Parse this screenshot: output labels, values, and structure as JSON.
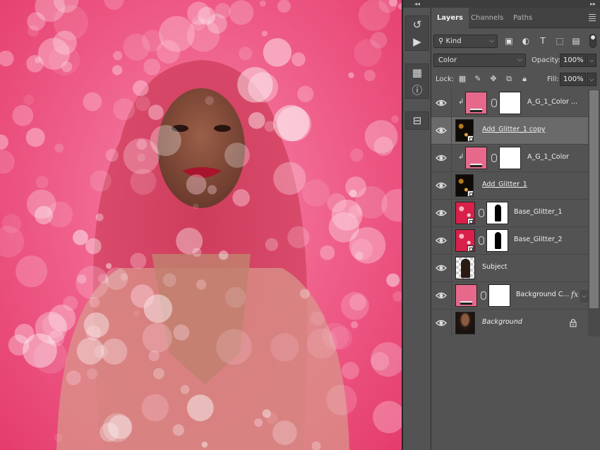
{
  "colors": {
    "canvas_pink": "#ee5a86",
    "fill_pink": "#e6698b",
    "panel_bg": "#535353",
    "selected_row": "#6a6a6a"
  },
  "canvas": {
    "content": "photo-of-woman-with-pink-bokeh-glitter"
  },
  "toolstrip": {
    "collapse_glyph": "◂◂",
    "groups": [
      {
        "tools": [
          {
            "icon": "history-brush-icon",
            "glyph": "↺"
          },
          {
            "icon": "play-icon",
            "glyph": "▶"
          }
        ]
      },
      {
        "tools": [
          {
            "icon": "properties-icon",
            "glyph": "▦"
          },
          {
            "icon": "info-icon",
            "glyph": "ⓘ"
          }
        ]
      },
      {
        "tools": [
          {
            "icon": "clone-source-icon",
            "glyph": "⊟"
          }
        ]
      }
    ]
  },
  "panel": {
    "collapse_glyph": "▸▸",
    "tabs": [
      {
        "label": "Layers",
        "active": true
      },
      {
        "label": "Channels",
        "active": false
      },
      {
        "label": "Paths",
        "active": false
      }
    ],
    "filter": {
      "kind_label": "Kind",
      "icons": [
        "pixel-filter-icon",
        "adjustment-filter-icon",
        "type-filter-icon",
        "shape-filter-icon",
        "smart-object-filter-icon"
      ]
    },
    "blend_mode": "Color",
    "opacity_label": "Opacity:",
    "opacity_value": "100%",
    "lock_label": "Lock:",
    "lock_icons": [
      "lock-transparent-pixels-icon",
      "lock-image-pixels-icon",
      "lock-position-icon",
      "lock-artboard-icon",
      "lock-all-icon"
    ],
    "fill_label": "Fill:",
    "fill_value": "100%"
  },
  "layers": [
    {
      "name": "A_G_1_Color ...",
      "type": "fill",
      "clipped": true,
      "selected": false,
      "underline": false,
      "italic": false
    },
    {
      "name": "Add_Glitter_1 copy",
      "type": "smart-dark",
      "clipped": false,
      "selected": true,
      "underline": true,
      "italic": false
    },
    {
      "name": "A_G_1_Color",
      "type": "fill",
      "clipped": true,
      "selected": false,
      "underline": false,
      "italic": false
    },
    {
      "name": "Add_Glitter_1",
      "type": "smart-dark",
      "clipped": false,
      "selected": false,
      "underline": true,
      "italic": false
    },
    {
      "name": "Base_Glitter_1",
      "type": "glitter-mask",
      "clipped": false,
      "selected": false,
      "underline": false,
      "italic": false
    },
    {
      "name": "Base_Glitter_2",
      "type": "glitter-mask",
      "clipped": false,
      "selected": false,
      "underline": false,
      "italic": false
    },
    {
      "name": "Subject",
      "type": "subject",
      "clipped": false,
      "selected": false,
      "underline": false,
      "italic": false
    },
    {
      "name": "Background C...",
      "type": "fill-fx",
      "clipped": false,
      "selected": false,
      "underline": false,
      "italic": false,
      "fx_label": "fx"
    },
    {
      "name": "Background",
      "type": "background",
      "clipped": false,
      "selected": false,
      "underline": false,
      "italic": true,
      "locked": true
    }
  ]
}
